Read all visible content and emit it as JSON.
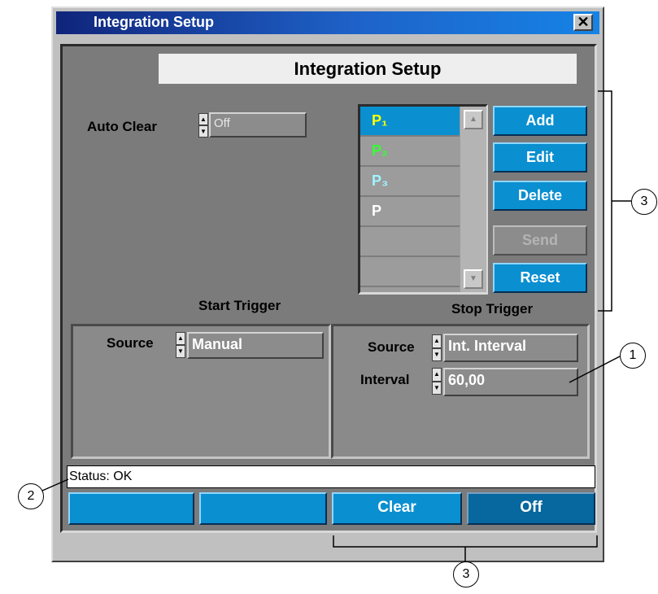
{
  "window": {
    "title": "Integration Setup",
    "close_glyph": "✕"
  },
  "header": {
    "title": "Integration Setup"
  },
  "auto_clear": {
    "label": "Auto Clear",
    "value": "Off"
  },
  "peaks": {
    "items": [
      {
        "label": "P₁",
        "color": "#ffff00",
        "selected": true
      },
      {
        "label": "P₂",
        "color": "#33ff33",
        "selected": false
      },
      {
        "label": "P₃",
        "color": "#9ff5ff",
        "selected": false
      },
      {
        "label": "P",
        "color": "#ffffff",
        "selected": false
      },
      {
        "label": "",
        "color": "#ffffff",
        "selected": false
      },
      {
        "label": "",
        "color": "#ffffff",
        "selected": false
      }
    ],
    "selected_color": "#0a8fd0",
    "scroll_up_icon": "▲",
    "scroll_down_icon": "▼"
  },
  "buttons": {
    "add": "Add",
    "edit": "Edit",
    "delete": "Delete",
    "send": "Send",
    "reset": "Reset"
  },
  "start_trigger": {
    "title": "Start Trigger",
    "source_label": "Source",
    "source_value": "Manual"
  },
  "stop_trigger": {
    "title": "Stop Trigger",
    "source_label": "Source",
    "source_value": "Int. Interval",
    "interval_label": "Interval",
    "interval_value": "60,00"
  },
  "status": {
    "text": "Status: OK"
  },
  "bottom_buttons": [
    "",
    "",
    "Clear",
    "Off"
  ],
  "callouts": {
    "one": "1",
    "two": "2",
    "three_top": "3",
    "three_bottom": "3"
  },
  "colors": {
    "accent": "#0a8fd0",
    "panel": "#7b7b7b",
    "titlebar_start": "#10247b",
    "titlebar_end": "#1683e6"
  }
}
